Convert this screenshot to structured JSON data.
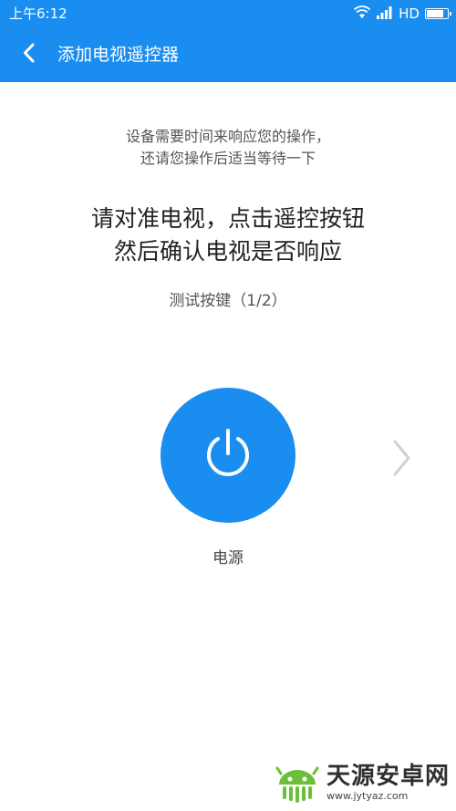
{
  "status_bar": {
    "time": "上午6:12",
    "network": "HD",
    "battery_level": 0.85,
    "icons": [
      "wifi-icon",
      "signal-icon",
      "battery-icon"
    ]
  },
  "header": {
    "title": "添加电视遥控器",
    "back_icon": "chevron-left-icon"
  },
  "main": {
    "hint_line1": "设备需要时间来响应您的操作，",
    "hint_line2": "还请您操作后适当等待一下",
    "instruction_line1": "请对准电视，点击遥控按钮",
    "instruction_line2": "然后确认电视是否响应",
    "step_label": "测试按键（1/2）",
    "key_icon": "power-icon",
    "key_label": "电源",
    "next_icon": "chevron-right-icon"
  },
  "watermark": {
    "name": "天源安卓网",
    "url": "www.jytyaz.com"
  },
  "colors": {
    "accent": "#1a8df0",
    "text_dark": "#222222",
    "text_muted": "#555555",
    "chevron_gray": "#d0d0d0"
  }
}
